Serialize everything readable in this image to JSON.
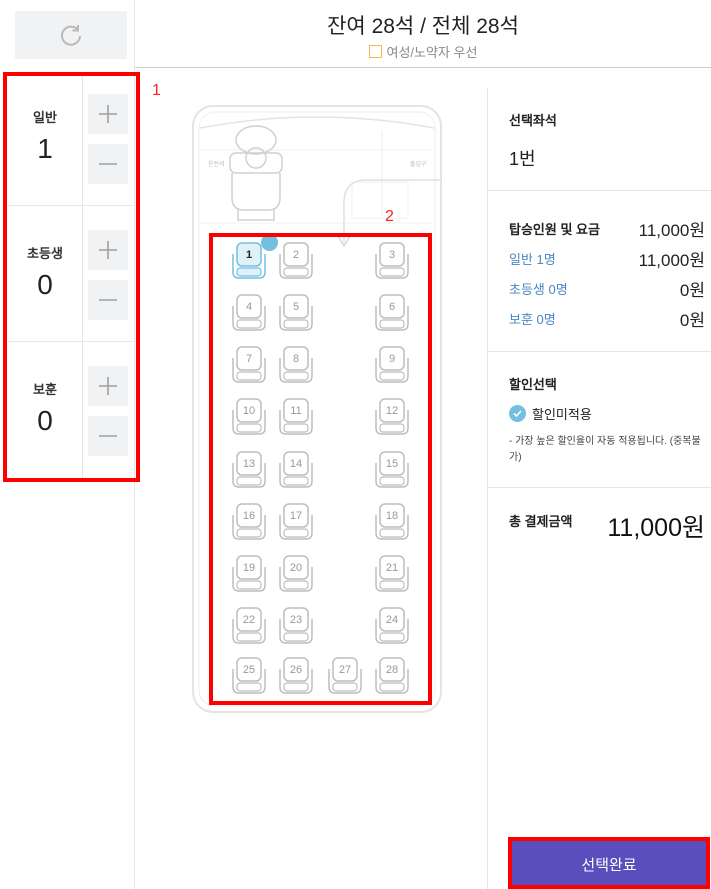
{
  "header": {
    "title": "잔여 28석 / 전체 28석",
    "female_senior_label": "여성/노약자 우선"
  },
  "counters": [
    {
      "label": "일반",
      "value": "1"
    },
    {
      "label": "초등생",
      "value": "0"
    },
    {
      "label": "보훈",
      "value": "0"
    }
  ],
  "annotations": {
    "box1": "1",
    "box2": "2",
    "box3": ""
  },
  "bus": {
    "driver_label": "운전석",
    "door_label": "출입구",
    "seats": [
      "1",
      "2",
      "3",
      "4",
      "5",
      "6",
      "7",
      "8",
      "9",
      "10",
      "11",
      "12",
      "13",
      "14",
      "15",
      "16",
      "17",
      "18",
      "19",
      "20",
      "21",
      "22",
      "23",
      "24",
      "25",
      "26",
      "27",
      "28"
    ],
    "selected_seat": "1"
  },
  "summary": {
    "selected_title": "선택좌석",
    "selected_value": "1번",
    "fare_title": "탑승인원 및 요금",
    "fare_total": "11,000원",
    "rows": [
      {
        "label": "일반 1명",
        "amount": "11,000원"
      },
      {
        "label": "초등생 0명",
        "amount": "0원"
      },
      {
        "label": "보훈 0명",
        "amount": "0원"
      }
    ],
    "discount_title": "할인선택",
    "discount_option": "할인미적용",
    "discount_note": "- 가장 높은 할인율이 자동 적용됩니다. (중복불가)",
    "total_title": "총 결제금액",
    "total_amount": "11,000원"
  },
  "buttons": {
    "done": "선택완료"
  },
  "colors": {
    "accent": "#5a4ebd",
    "selected_seat": "#73bfe0",
    "link_blue": "#4a87c5",
    "highlight": "#ff0000",
    "female_box": "#f3b94a"
  }
}
